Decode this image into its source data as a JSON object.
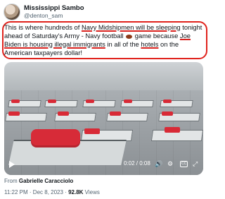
{
  "author": {
    "display_name": "Mississippi Sambo",
    "handle": "@denton_sam"
  },
  "tweet": {
    "text_segments": [
      "This is where hundreds of ",
      "Navy Midshipmen will be sleeping",
      " tonight ahead of Saturday's Army - Navy football ",
      " game because ",
      "Joe Biden is housing illegal immigrants",
      " in all of the ",
      "hotels",
      " on the American taxpayers dollar!"
    ]
  },
  "video": {
    "time": "0:02 / 0:08"
  },
  "from": {
    "label": "From",
    "creator": "Gabrielle Caracciolo"
  },
  "meta": {
    "time": "11:22 PM",
    "dot": "·",
    "date": "Dec 8, 2023",
    "views_count": "92.8K",
    "views_label": "Views"
  }
}
